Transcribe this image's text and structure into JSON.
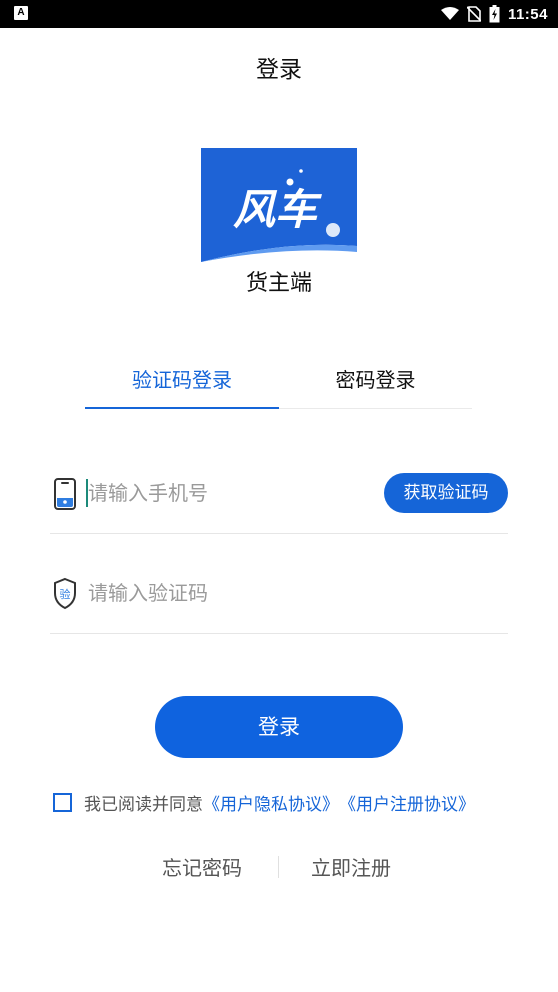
{
  "status_bar": {
    "time": "11:54"
  },
  "header": {
    "title": "登录"
  },
  "logo": {
    "brand_text": "风车",
    "subtitle": "货主端",
    "brand_color": "#1e63d6"
  },
  "tabs": [
    {
      "label": "验证码登录",
      "active": true
    },
    {
      "label": "密码登录",
      "active": false
    }
  ],
  "phone_field": {
    "placeholder": "请输入手机号",
    "value": "",
    "icon": "phone-icon"
  },
  "code_button": {
    "label": "获取验证码"
  },
  "code_field": {
    "placeholder": "请输入验证码",
    "value": "",
    "icon": "shield-verify-icon",
    "icon_text": "验"
  },
  "login_button": {
    "label": "登录"
  },
  "agreement": {
    "checked": false,
    "text": "我已阅读并同意",
    "privacy_link": "《用户隐私协议》",
    "register_link": "《用户注册协议》"
  },
  "footer_links": {
    "forgot": "忘记密码",
    "register": "立即注册"
  },
  "colors": {
    "accent": "#1565d8",
    "button": "#0f63df"
  }
}
